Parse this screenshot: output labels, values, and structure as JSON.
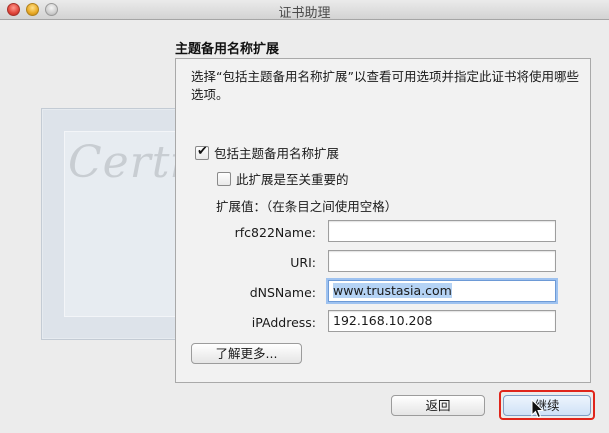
{
  "window": {
    "title": "证书助理"
  },
  "section": {
    "title": "主题备用名称扩展"
  },
  "description": "选择“包括主题备用名称扩展”以查看可用选项并指定此证书将使用哪些选项。",
  "options": {
    "include_extension": {
      "label": "包括主题备用名称扩展",
      "checked": true
    },
    "critical": {
      "label": "此扩展是至关重要的",
      "checked": false
    }
  },
  "values_hint": "扩展值：（在条目之间使用空格）",
  "fields": {
    "rfc822": {
      "label": "rfc822Name:",
      "value": ""
    },
    "uri": {
      "label": "URI:",
      "value": ""
    },
    "dns": {
      "label": "dNSName:",
      "value": "www.trustasia.com"
    },
    "ip": {
      "label": "iPAddress:",
      "value": "192.168.10.208"
    }
  },
  "buttons": {
    "learn_more": "了解更多...",
    "back": "返回",
    "continue": "继续"
  },
  "illustration": {
    "text": "Certificate"
  },
  "colors": {
    "highlight": "#e0251b",
    "focus": "#9ec2f0"
  }
}
